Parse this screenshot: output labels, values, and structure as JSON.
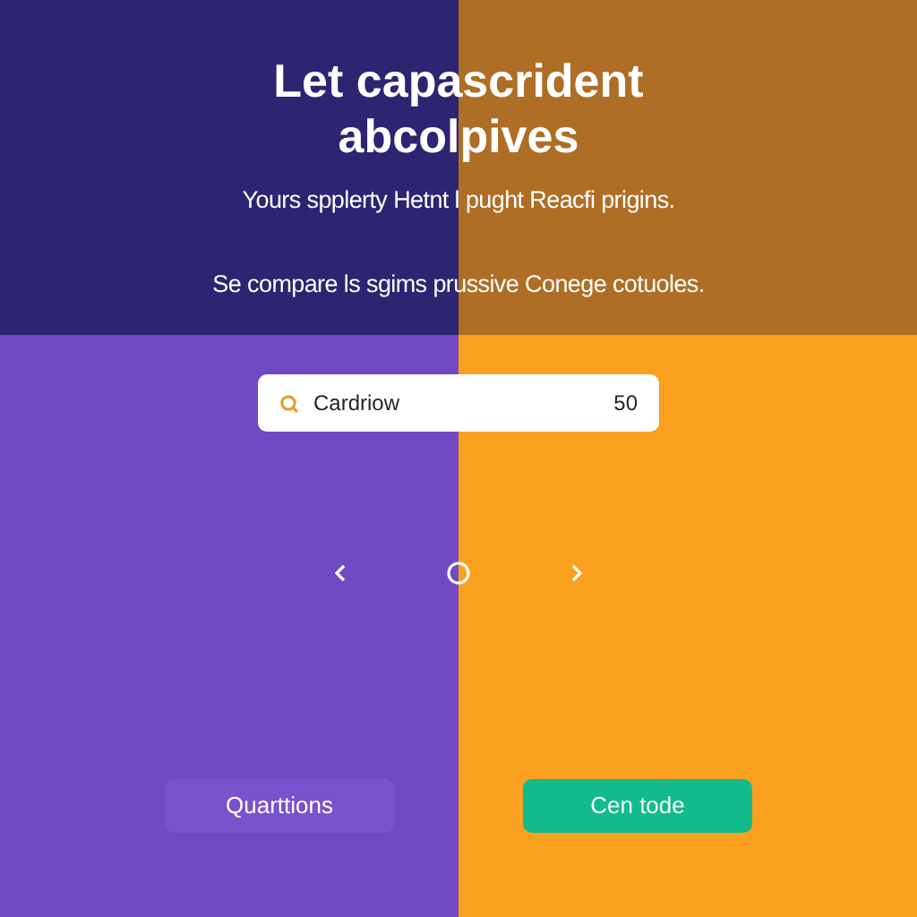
{
  "hero": {
    "title": "Let capascrident abcolpives",
    "subtitle": "Yours spplerty Hetnt l pught Reacfi prigins.",
    "note": "Se compare ls sgims prussive Conege cotuoles."
  },
  "search": {
    "value": "Cardriow",
    "count": "50"
  },
  "buttons": [
    {
      "label": "Quarttions",
      "kind": "secondary"
    },
    {
      "label": "Cen tode",
      "kind": "primary"
    }
  ]
}
